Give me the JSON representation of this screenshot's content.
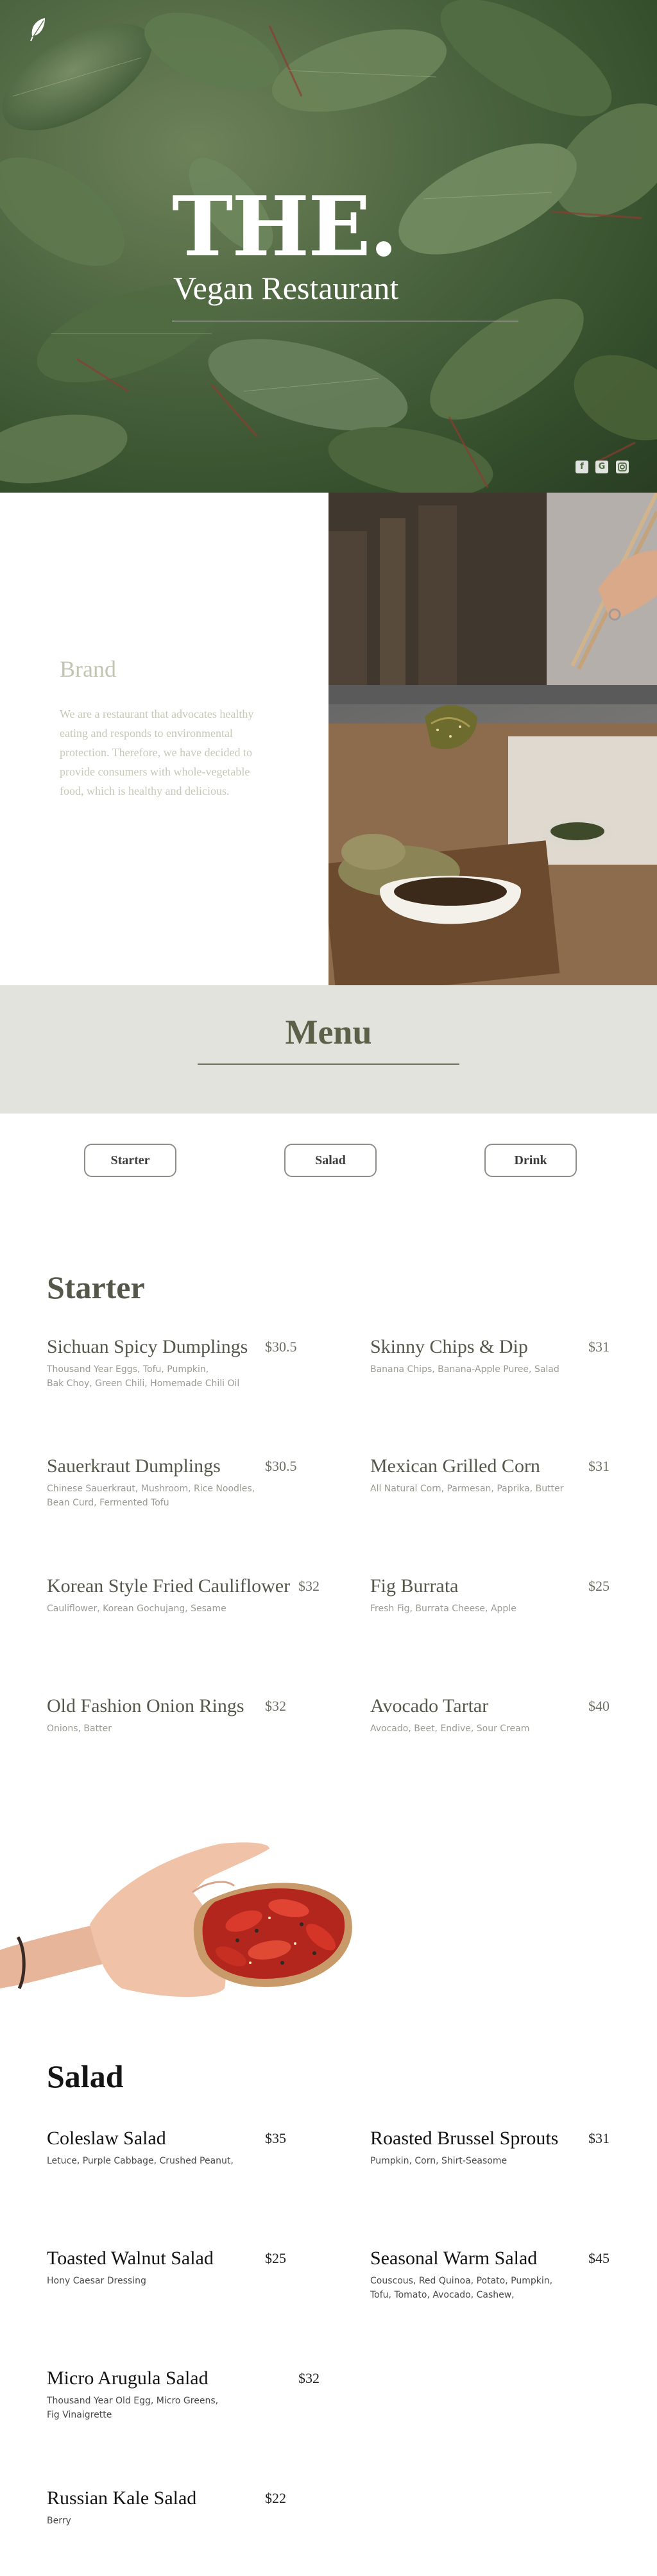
{
  "hero": {
    "title": "THE.",
    "subtitle": "Vegan Restaurant",
    "social_icons": [
      "facebook-icon",
      "google-icon",
      "instagram-icon"
    ]
  },
  "brand": {
    "title": "Brand",
    "text": "We are a restaurant that advocates healthy eating and responds to environmental protection. Therefore, we have decided to provide consumers with whole-vegetable food, which is healthy and delicious."
  },
  "menu": {
    "title": "Menu",
    "tabs": [
      "Starter",
      "Salad",
      "Drink"
    ]
  },
  "starter": {
    "title": "Starter",
    "items": [
      {
        "name": "Sichuan Spicy Dumplings",
        "price": "$30.5",
        "desc": "Thousand Year Eggs, Tofu, Pumpkin,\nBak Choy, Green Chili, Homemade Chili Oil"
      },
      {
        "name": "Skinny Chips & Dip",
        "price": "$31",
        "desc": "Banana Chips, Banana-Apple Puree, Salad"
      },
      {
        "name": "Sauerkraut Dumplings",
        "price": "$30.5",
        "desc": "Chinese Sauerkraut, Mushroom, Rice Noodles,\nBean Curd, Fermented Tofu"
      },
      {
        "name": "Mexican Grilled Corn",
        "price": "$31",
        "desc": "All Natural Corn, Parmesan, Paprika, Butter"
      },
      {
        "name": "Korean Style Fried Cauliflower",
        "price": "$32",
        "desc": "Cauliflower, Korean Gochujang, Sesame"
      },
      {
        "name": "Fig Burrata",
        "price": "$25",
        "desc": "Fresh Fig, Burrata Cheese, Apple"
      },
      {
        "name": "Old Fashion Onion Rings",
        "price": "$32",
        "desc": "Onions, Batter"
      },
      {
        "name": "Avocado Tartar",
        "price": "$40",
        "desc": "Avocado, Beet, Endive, Sour Cream"
      }
    ]
  },
  "salad": {
    "title": "Salad",
    "items": [
      {
        "name": "Coleslaw Salad",
        "price": "$35",
        "desc": "Letuce, Purple Cabbage, Crushed Peanut,"
      },
      {
        "name": "Roasted Brussel Sprouts",
        "price": "$31",
        "desc": "Pumpkin, Corn, Shirt-Seasome"
      },
      {
        "name": "Toasted Walnut Salad",
        "price": "$25",
        "desc": "Hony Caesar Dressing"
      },
      {
        "name": "Seasonal Warm Salad",
        "price": "$45",
        "desc": "Couscous, Red Quinoa, Potato, Pumpkin,\nTofu, Tomato, Avocado, Cashew,"
      },
      {
        "name": "Micro Arugula Salad",
        "price": "$32",
        "desc": "Thousand Year Old Egg, Micro Greens,\nFig Vinaigrette"
      },
      {
        "name": "Russian Kale Salad",
        "price": "$22",
        "desc": "Berry"
      }
    ]
  },
  "colors": {
    "menu_band": "#e2e3dc",
    "brand_text": "#c3c5b3",
    "menu_title": "#5d6049"
  }
}
